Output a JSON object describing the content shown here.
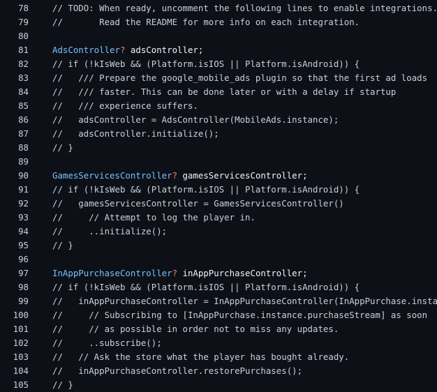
{
  "colors": {
    "background": "#0d1117",
    "line_number": "#c9d1d9",
    "comment": "#c9d1d9",
    "type": "#79c0ff",
    "operator": "#ff7b72",
    "plain": "#f0f6fc"
  },
  "code": {
    "lines": [
      {
        "num": "78",
        "tokens": [
          {
            "text": "// TODO: When ready, uncomment the following lines to enable integrations.",
            "kind": "comment"
          }
        ]
      },
      {
        "num": "79",
        "tokens": [
          {
            "text": "//       Read the README for more info on each integration.",
            "kind": "comment"
          }
        ]
      },
      {
        "num": "80",
        "tokens": []
      },
      {
        "num": "81",
        "tokens": [
          {
            "text": "AdsController",
            "kind": "type"
          },
          {
            "text": "?",
            "kind": "op"
          },
          {
            "text": " adsController;",
            "kind": "plain"
          }
        ]
      },
      {
        "num": "82",
        "tokens": [
          {
            "text": "// if (!kIsWeb && (Platform.isIOS || Platform.isAndroid)) {",
            "kind": "comment"
          }
        ]
      },
      {
        "num": "83",
        "tokens": [
          {
            "text": "//   /// Prepare the google_mobile_ads plugin so that the first ad loads",
            "kind": "comment"
          }
        ]
      },
      {
        "num": "84",
        "tokens": [
          {
            "text": "//   /// faster. This can be done later or with a delay if startup",
            "kind": "comment"
          }
        ]
      },
      {
        "num": "85",
        "tokens": [
          {
            "text": "//   /// experience suffers.",
            "kind": "comment"
          }
        ]
      },
      {
        "num": "86",
        "tokens": [
          {
            "text": "//   adsController = AdsController(MobileAds.instance);",
            "kind": "comment"
          }
        ]
      },
      {
        "num": "87",
        "tokens": [
          {
            "text": "//   adsController.initialize();",
            "kind": "comment"
          }
        ]
      },
      {
        "num": "88",
        "tokens": [
          {
            "text": "// }",
            "kind": "comment"
          }
        ]
      },
      {
        "num": "89",
        "tokens": []
      },
      {
        "num": "90",
        "tokens": [
          {
            "text": "GamesServicesController",
            "kind": "type"
          },
          {
            "text": "?",
            "kind": "op"
          },
          {
            "text": " gamesServicesController;",
            "kind": "plain"
          }
        ]
      },
      {
        "num": "91",
        "tokens": [
          {
            "text": "// if (!kIsWeb && (Platform.isIOS || Platform.isAndroid)) {",
            "kind": "comment"
          }
        ]
      },
      {
        "num": "92",
        "tokens": [
          {
            "text": "//   gamesServicesController = GamesServicesController()",
            "kind": "comment"
          }
        ]
      },
      {
        "num": "93",
        "tokens": [
          {
            "text": "//     // Attempt to log the player in.",
            "kind": "comment"
          }
        ]
      },
      {
        "num": "94",
        "tokens": [
          {
            "text": "//     ..initialize();",
            "kind": "comment"
          }
        ]
      },
      {
        "num": "95",
        "tokens": [
          {
            "text": "// }",
            "kind": "comment"
          }
        ]
      },
      {
        "num": "96",
        "tokens": []
      },
      {
        "num": "97",
        "tokens": [
          {
            "text": "InAppPurchaseController",
            "kind": "type"
          },
          {
            "text": "?",
            "kind": "op"
          },
          {
            "text": " inAppPurchaseController;",
            "kind": "plain"
          }
        ]
      },
      {
        "num": "98",
        "tokens": [
          {
            "text": "// if (!kIsWeb && (Platform.isIOS || Platform.isAndroid)) {",
            "kind": "comment"
          }
        ]
      },
      {
        "num": "99",
        "tokens": [
          {
            "text": "//   inAppPurchaseController = InAppPurchaseController(InAppPurchase.instance",
            "kind": "comment"
          }
        ]
      },
      {
        "num": "100",
        "tokens": [
          {
            "text": "//     // Subscribing to [InAppPurchase.instance.purchaseStream] as soon",
            "kind": "comment"
          }
        ]
      },
      {
        "num": "101",
        "tokens": [
          {
            "text": "//     // as possible in order not to miss any updates.",
            "kind": "comment"
          }
        ]
      },
      {
        "num": "102",
        "tokens": [
          {
            "text": "//     ..subscribe();",
            "kind": "comment"
          }
        ]
      },
      {
        "num": "103",
        "tokens": [
          {
            "text": "//   // Ask the store what the player has bought already.",
            "kind": "comment"
          }
        ]
      },
      {
        "num": "104",
        "tokens": [
          {
            "text": "//   inAppPurchaseController.restorePurchases();",
            "kind": "comment"
          }
        ]
      },
      {
        "num": "105",
        "tokens": [
          {
            "text": "// }",
            "kind": "comment"
          }
        ]
      }
    ]
  }
}
